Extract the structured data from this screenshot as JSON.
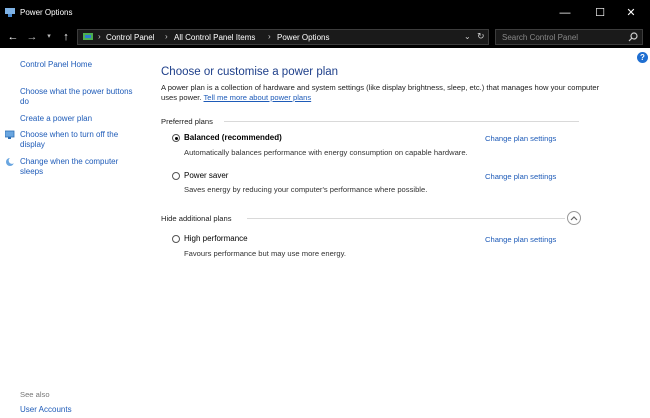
{
  "window": {
    "title": "Power Options"
  },
  "controls": {
    "minimize": "—",
    "maximize": "☐",
    "close": "✕"
  },
  "address": {
    "crumbs": [
      "Control Panel",
      "All Control Panel Items",
      "Power Options"
    ],
    "search_placeholder": "Search Control Panel"
  },
  "sidebar": {
    "home": "Control Panel Home",
    "links": [
      {
        "label": "Choose what the power buttons do"
      },
      {
        "label": "Create a power plan"
      },
      {
        "label": "Choose when to turn off the display"
      },
      {
        "label": "Change when the computer sleeps"
      }
    ],
    "see_also": "See also",
    "user_accounts": "User Accounts"
  },
  "main": {
    "heading": "Choose or customise a power plan",
    "intro_text": "A power plan is a collection of hardware and system settings (like display brightness, sleep, etc.) that manages how your computer uses power.",
    "intro_link": "Tell me more about power plans",
    "preferred_title": "Preferred plans",
    "additional_title": "Hide additional plans",
    "change_label": "Change plan settings",
    "plans": [
      {
        "name": "Balanced (recommended)",
        "desc": "Automatically balances performance with energy consumption on capable hardware.",
        "selected": true
      },
      {
        "name": "Power saver",
        "desc": "Saves energy by reducing your computer's performance where possible.",
        "selected": false
      },
      {
        "name": "High performance",
        "desc": "Favours performance but may use more energy.",
        "selected": false
      }
    ]
  },
  "colors": {
    "accent": "#1e5bb8",
    "heading": "#1e3f8a",
    "titlebar": "#000000"
  }
}
